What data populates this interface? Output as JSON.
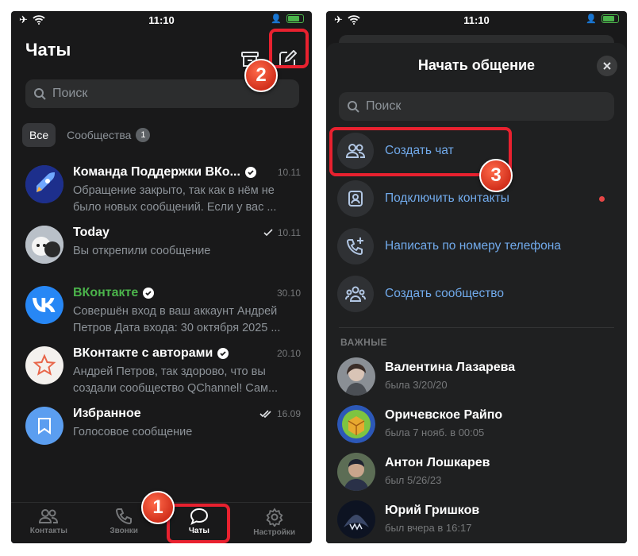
{
  "status_bar": {
    "time": "11:10"
  },
  "left": {
    "title": "Чаты",
    "search": {
      "placeholder": "Поиск"
    },
    "filters": {
      "all": "Все",
      "communities": "Сообщества",
      "communities_count": "1"
    },
    "chats": [
      {
        "name": "Команда Поддержки ВКо...",
        "time": "10.11",
        "verified": true,
        "message": "Обращение закрыто, так как в нём не было новых сообщений. Если у вас ..."
      },
      {
        "name": "Today",
        "time": "10.11",
        "read": "single",
        "message": "Вы открепили сообщение"
      },
      {
        "name": "ВКонтакте",
        "time": "30.10",
        "verified": true,
        "message": "Совершён вход в ваш аккаунт Андрей Петров Дата входа: 30 октября 2025 ..."
      },
      {
        "name": "ВКонтакте с авторами",
        "time": "20.10",
        "verified": true,
        "message": "Андрей Петров, так здорово, что вы создали сообщество QChannel! Сам..."
      },
      {
        "name": "Избранное",
        "time": "16.09",
        "read": "double",
        "message": "Голосовое сообщение"
      }
    ],
    "tabbar": [
      {
        "label": "Контакты",
        "icon": "contacts-icon"
      },
      {
        "label": "Звонки",
        "icon": "phone-icon"
      },
      {
        "label": "Чаты",
        "icon": "chat-bubble-icon",
        "active": true
      },
      {
        "label": "Настройки",
        "icon": "gear-icon"
      }
    ]
  },
  "right": {
    "title": "Начать общение",
    "search": {
      "placeholder": "Поиск"
    },
    "actions": [
      {
        "label": "Создать чат",
        "icon": "users-icon"
      },
      {
        "label": "Подключить контакты",
        "icon": "contact-card-icon",
        "dot": true
      },
      {
        "label": "Написать по номеру телефона",
        "icon": "phone-plus-icon"
      },
      {
        "label": "Создать сообщество",
        "icon": "community-icon"
      }
    ],
    "section_label": "ВАЖНЫЕ",
    "contacts": [
      {
        "name": "Валентина Лазарева",
        "status": "была 3/20/20"
      },
      {
        "name": "Оричевское Райпо",
        "status": "была 7 нояб. в 00:05"
      },
      {
        "name": "Антон Лошкарев",
        "status": "был 5/26/23"
      },
      {
        "name": "Юрий Гришков",
        "status": "был вчера в 16:17"
      }
    ]
  },
  "annotations": {
    "step1": "1",
    "step2": "2",
    "step3": "3",
    "accent": "#e8212f"
  },
  "colors": {
    "background": "#19191a",
    "link": "#71aaeb",
    "verified": "#ffffff",
    "vk_blue": "#2787f5"
  }
}
